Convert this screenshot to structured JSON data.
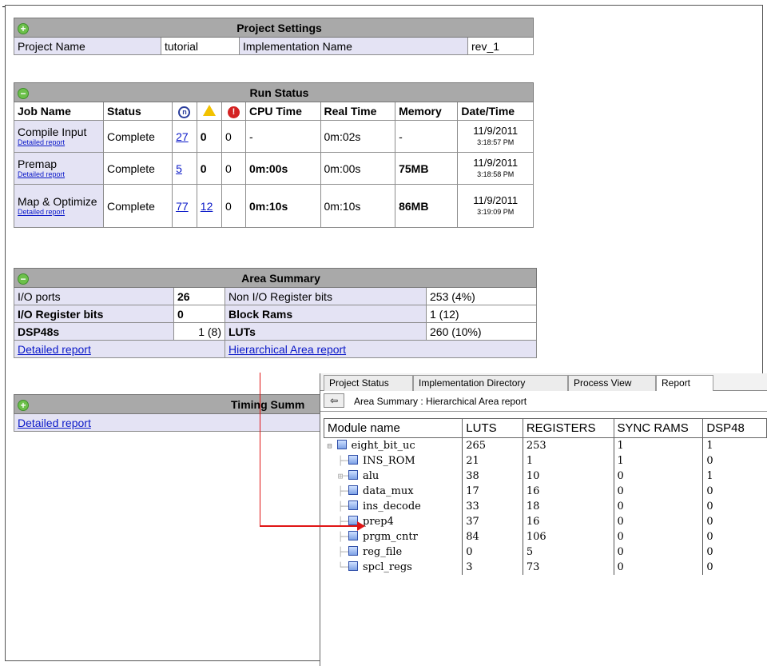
{
  "project_settings": {
    "title": "Project Settings",
    "project_name_label": "Project Name",
    "project_name_value": "tutorial",
    "impl_name_label": "Implementation Name",
    "impl_name_value": "rev_1"
  },
  "run_status": {
    "title": "Run Status",
    "columns": [
      "Job Name",
      "Status",
      "",
      "",
      "",
      "CPU Time",
      "Real Time",
      "Memory",
      "Date/Time"
    ],
    "detail_link": "Detailed report",
    "rows": [
      {
        "job": "Compile Input",
        "status": "Complete",
        "notes": "27",
        "warnings": "0",
        "errors": "0",
        "cpu": "-",
        "real": "0m:02s",
        "memory": "-",
        "date": "11/9/2011",
        "time": "3:18:57 PM"
      },
      {
        "job": "Premap",
        "status": "Complete",
        "notes": "5",
        "warnings": "0",
        "errors": "0",
        "cpu": "0m:00s",
        "real": "0m:00s",
        "memory": "75MB",
        "date": "11/9/2011",
        "time": "3:18:58 PM"
      },
      {
        "job": "Map & Optimize",
        "status": "Complete",
        "notes": "77",
        "warnings": "12",
        "errors": "0",
        "cpu": "0m:10s",
        "real": "0m:10s",
        "memory": "86MB",
        "date": "11/9/2011",
        "time": "3:19:09 PM"
      }
    ]
  },
  "area_summary": {
    "title": "Area Summary",
    "io_ports_label": "I/O ports",
    "io_ports_value": "26",
    "non_io_label": "Non I/O Register bits",
    "non_io_value": "253 (4%)",
    "io_reg_label": "I/O Register bits",
    "io_reg_value": "0",
    "block_rams_label": "Block Rams",
    "block_rams_value": "1 (12)",
    "dsp_label": "DSP48s",
    "dsp_value": "1 (8)",
    "luts_label": "LUTs",
    "luts_value": "260 (10%)",
    "detailed_link": "Detailed report",
    "hier_link": "Hierarchical Area report"
  },
  "timing_summary": {
    "title": "Timing Summ",
    "detailed_link": "Detailed report"
  },
  "report_panel": {
    "tabs": [
      "Project Status",
      "Implementation Directory",
      "Process View",
      "Report"
    ],
    "active_tab": "Report",
    "breadcrumb": "Area Summary : Hierarchical Area report",
    "columns": [
      "Module name",
      "LUTS",
      "REGISTERS",
      "SYNC RAMS",
      "DSP48"
    ],
    "rows": [
      {
        "name": "eight_bit_uc",
        "luts": "265",
        "registers": "253",
        "sync_rams": "1",
        "dsp48": "1"
      },
      {
        "name": "INS_ROM",
        "luts": "21",
        "registers": "1",
        "sync_rams": "1",
        "dsp48": "0"
      },
      {
        "name": "alu",
        "luts": "38",
        "registers": "10",
        "sync_rams": "0",
        "dsp48": "1"
      },
      {
        "name": "data_mux",
        "luts": "17",
        "registers": "16",
        "sync_rams": "0",
        "dsp48": "0"
      },
      {
        "name": "ins_decode",
        "luts": "33",
        "registers": "18",
        "sync_rams": "0",
        "dsp48": "0"
      },
      {
        "name": "prep4",
        "luts": "37",
        "registers": "16",
        "sync_rams": "0",
        "dsp48": "0"
      },
      {
        "name": "prgm_cntr",
        "luts": "84",
        "registers": "106",
        "sync_rams": "0",
        "dsp48": "0"
      },
      {
        "name": "reg_file",
        "luts": "0",
        "registers": "5",
        "sync_rams": "0",
        "dsp48": "0"
      },
      {
        "name": "spcl_regs",
        "luts": "3",
        "registers": "73",
        "sync_rams": "0",
        "dsp48": "0"
      }
    ]
  },
  "colors": {
    "header_gray": "#a9a9a9",
    "label_lavender": "#e4e3f4",
    "link_blue": "#0a18c8",
    "arrow_red": "#e01515"
  }
}
